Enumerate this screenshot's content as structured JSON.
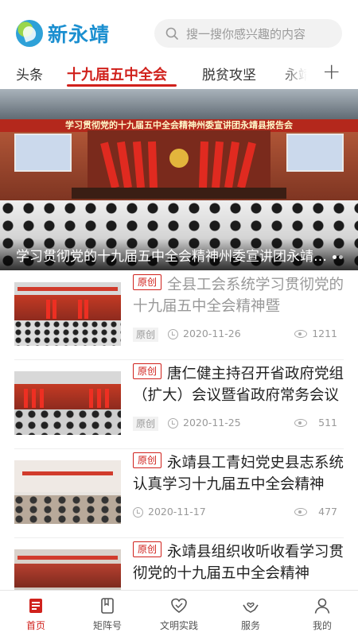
{
  "app": {
    "logo_text": "新永靖",
    "accent_color": "#d0211c",
    "logo_color": "#1b8fd0"
  },
  "search": {
    "placeholder": "搜一搜你感兴趣的内容",
    "icon": "search-icon"
  },
  "tabs": [
    {
      "label": "头条",
      "active": false
    },
    {
      "label": "十九届五中全会",
      "active": true
    },
    {
      "label": "脱贫攻坚",
      "active": false
    },
    {
      "label": "永靖",
      "active": false
    }
  ],
  "tabs_add_label": "+",
  "banner": {
    "slogan": "学习贯彻党的十九届五中全会精神州委宣讲团永靖县报告会",
    "caption": "学习贯彻党的十九届五中全会精神州委宣讲团永靖县报告会",
    "slide_count": 2,
    "active_slide": 1
  },
  "news": [
    {
      "tag": "原创",
      "title": "全县工会系统学习贯彻党的十九届五中全会精神暨",
      "source": "原创",
      "date": "2020-11-26",
      "views": "1211",
      "read": true
    },
    {
      "tag": "原创",
      "title": "唐仁健主持召开省政府党组（扩大）会议暨省政府常务会议",
      "source": "原创",
      "date": "2020-11-25",
      "views": "511",
      "read": false
    },
    {
      "tag": "原创",
      "title": "永靖县工青妇党史县志系统认真学习十九届五中全会精神",
      "source": "",
      "date": "2020-11-17",
      "views": "477",
      "read": false
    },
    {
      "tag": "原创",
      "title": "永靖县组织收听收看学习贯彻党的十九届五中全会精神",
      "source": "",
      "date": "",
      "views": "",
      "read": false
    }
  ],
  "bottom_nav": [
    {
      "label": "首页",
      "icon": "home-news-icon",
      "active": true
    },
    {
      "label": "矩阵号",
      "icon": "bookmark-icon",
      "active": false
    },
    {
      "label": "文明实践",
      "icon": "heart-icon",
      "active": false
    },
    {
      "label": "服务",
      "icon": "service-hands-icon",
      "active": false
    },
    {
      "label": "我的",
      "icon": "user-icon",
      "active": false
    }
  ]
}
